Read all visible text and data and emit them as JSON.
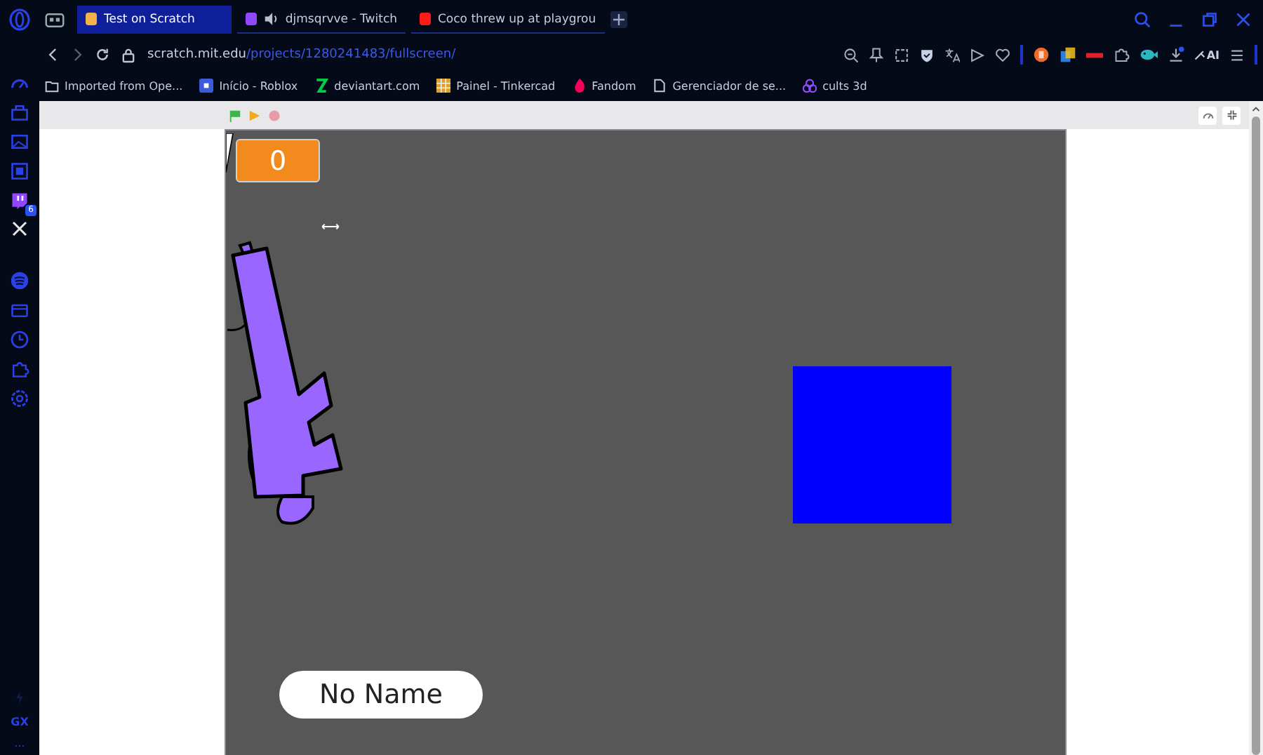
{
  "tabs": [
    {
      "title": "Test on Scratch",
      "selected": true,
      "color": "#f2b24a",
      "audio": false
    },
    {
      "title": "djmsqrvve - Twitch",
      "selected": false,
      "color": "#9146ff",
      "audio": true
    },
    {
      "title": "Coco threw up at playgrou",
      "selected": false,
      "color": "#ff1a1a",
      "audio": false
    }
  ],
  "address": {
    "host": "scratch.mit.edu",
    "path": "/projects/1280241483/fullscreen/"
  },
  "toolbar": {
    "ai_label": "AI"
  },
  "bookmarks": [
    {
      "label": "Imported from Ope...",
      "kind": "folder",
      "color": "#c8c8d0"
    },
    {
      "label": "Início - Roblox",
      "kind": "square",
      "color": "#3b5bdb"
    },
    {
      "label": "deviantart.com",
      "kind": "zig",
      "color": "#05cc47"
    },
    {
      "label": "Painel - Tinkercad",
      "kind": "grid",
      "color": "#e0a030"
    },
    {
      "label": "Fandom",
      "kind": "flame",
      "color": "#fa005a"
    },
    {
      "label": "Gerenciador de se...",
      "kind": "page",
      "color": "#c8c8d0"
    },
    {
      "label": "cults 3d",
      "kind": "cults",
      "color": "#8a4dff"
    }
  ],
  "sidebar": {
    "badge": "6",
    "gx_label": "GX",
    "more_label": "..."
  },
  "stage": {
    "score": "0",
    "name": "No Name"
  }
}
